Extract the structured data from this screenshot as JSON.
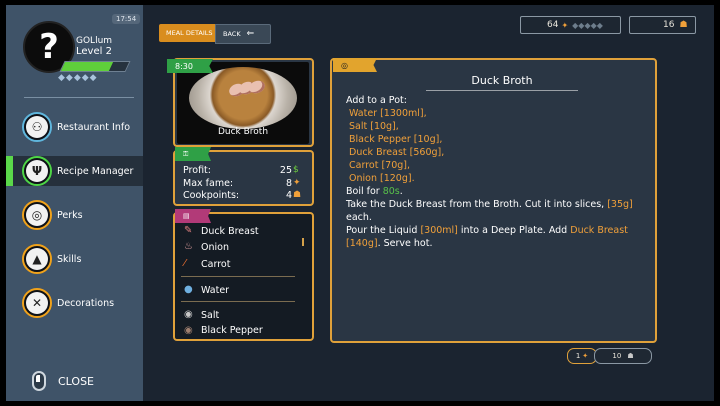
{
  "sidebar": {
    "time": "17:54",
    "avatar_glyph": "?",
    "username": "GOLlum",
    "level": "Level 2",
    "xp_fraction": 0.75,
    "stars": "◆◆◆◆◆",
    "items": [
      {
        "label": "Restaurant Info",
        "icon": "restaurant-info-icon"
      },
      {
        "label": "Recipe Manager",
        "icon": "recipe-manager-icon"
      },
      {
        "label": "Perks",
        "icon": "perks-icon"
      },
      {
        "label": "Skills",
        "icon": "skills-icon"
      },
      {
        "label": "Decorations",
        "icon": "decorations-icon"
      }
    ],
    "active_item": "Recipe Manager",
    "close_label": "CLOSE"
  },
  "header": {
    "tab_details": "MEAL DETAILS",
    "tab_back": "BACK",
    "resource_left_value": "64",
    "resource_left_stars": "◆◆◆◆◆",
    "resource_right_value": "16"
  },
  "meal": {
    "time": "8:30",
    "name": "Duck Broth",
    "stats": {
      "profit_label": "Profit:",
      "profit_value": "25",
      "fame_label": "Max fame:",
      "fame_value": "8",
      "cookpoints_label": "Cookpoints:",
      "cookpoints_value": "4"
    },
    "ingredients": [
      "Duck Breast",
      "Onion",
      "Carrot",
      "Water",
      "Salt",
      "Black Pepper"
    ]
  },
  "recipe": {
    "title": "Duck Broth",
    "intro": "Add to a Pot:",
    "items": [
      "Water [1300ml],",
      "Salt [10g],",
      "Black Pepper [10g],",
      "Duck Breast [560g],",
      "Carrot [70g],",
      "Onion [120g]."
    ],
    "boil_prefix": "Boil for ",
    "boil_time": "80s",
    "boil_suffix": ".",
    "step2_prefix": "Take the Duck Breast from the Broth. Cut it into slices, ",
    "step2_amount": "[35g]",
    "step2_suffix": "each.",
    "step3_prefix": "Pour the Liquid ",
    "step3_amount": "[300ml]",
    "step3_mid": " into a Deep Plate. Add ",
    "step3_item": "Duck Breast",
    "step3_item_amount": "[140g]",
    "step3_suffix": ". Serve hot."
  },
  "footer": {
    "page_left": "1",
    "page_right": "10"
  },
  "colors": {
    "accent": "#f0a03a",
    "green": "#58c04a",
    "panel_border": "#e0a13a"
  }
}
